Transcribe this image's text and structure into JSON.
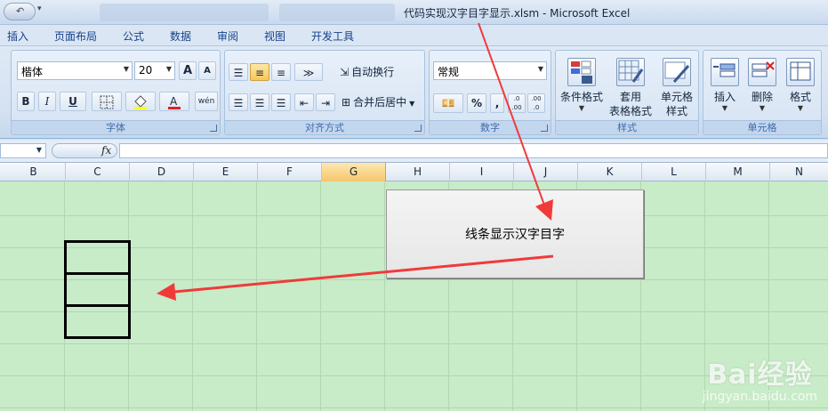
{
  "window": {
    "title": "代码实现汉字目字显示.xlsm - Microsoft Excel"
  },
  "menu": {
    "tabs": [
      "插入",
      "页面布局",
      "公式",
      "数据",
      "审阅",
      "视图",
      "开发工具"
    ]
  },
  "ribbon": {
    "font": {
      "group_label": "字体",
      "font_name": "楷体",
      "font_size": "20",
      "grow_icon": "A",
      "shrink_icon": "A",
      "bold": "B",
      "italic": "I",
      "underline": "U",
      "phonetic": "wén"
    },
    "alignment": {
      "group_label": "对齐方式",
      "wrap_text": "自动换行",
      "merge_center": "合并后居中"
    },
    "number": {
      "group_label": "数字",
      "format": "常规",
      "percent": "%",
      "comma": ",",
      "inc_decimal": ".0 .00",
      "dec_decimal": ".00 .0"
    },
    "styles": {
      "group_label": "样式",
      "conditional_format": "条件格式",
      "table_format_line1": "套用",
      "table_format_line2": "表格格式",
      "cell_styles_line1": "单元格",
      "cell_styles_line2": "样式"
    },
    "cells": {
      "group_label": "单元格",
      "insert": "插入",
      "delete": "删除",
      "format": "格式"
    }
  },
  "formula_bar": {
    "fx": "fx",
    "value": ""
  },
  "columns": [
    "B",
    "C",
    "D",
    "E",
    "F",
    "G",
    "H",
    "I",
    "J",
    "K",
    "L",
    "M",
    "N"
  ],
  "selected_column": "G",
  "sheet": {
    "macro_button_label": "线条显示汉字目字"
  },
  "colors": {
    "sheet_bg": "#c8ebc8",
    "arrow": "#f03a3a",
    "ribbon_bg": "#dfe9f5"
  },
  "watermark": {
    "logo": "Bai经验",
    "url": "jingyan.baidu.com"
  }
}
